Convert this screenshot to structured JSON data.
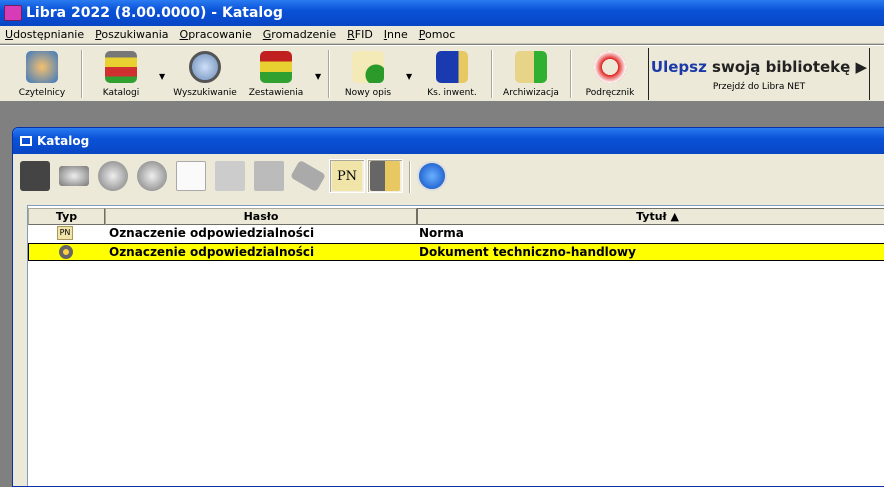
{
  "app": {
    "title": "Libra 2022 (8.00.0000) - Katalog"
  },
  "menu": [
    "Udostępnianie",
    "Poszukiwania",
    "Opracowanie",
    "Gromadzenie",
    "RFID",
    "Inne",
    "Pomoc"
  ],
  "toolbar": [
    {
      "label": "Czytelnicy",
      "icon": "readers-icon"
    },
    {
      "label": "Katalogi",
      "icon": "filing-cabinet-icon"
    },
    {
      "label": "Wyszukiwanie",
      "icon": "magnifier-icon"
    },
    {
      "label": "Zestawienia",
      "icon": "books-stack-icon"
    },
    {
      "label": "Nowy opis",
      "icon": "new-record-icon"
    },
    {
      "label": "Ks. inwent.",
      "icon": "inventory-book-icon"
    },
    {
      "label": "Archiwizacja",
      "icon": "archive-folder-icon"
    },
    {
      "label": "Podręcznik",
      "icon": "lifebuoy-icon"
    }
  ],
  "promo": {
    "highlight": "Ulepsz",
    "rest": " swoją bibliotekę ▶",
    "link": "Przejdź do Libra NET"
  },
  "window": {
    "title": "Katalog",
    "pn_label": "PN"
  },
  "table": {
    "columns": [
      "Typ",
      "Hasło",
      "Tytuł ▲"
    ],
    "rows": [
      {
        "type": "PN",
        "haslo": "Oznaczenie odpowiedzialności",
        "tytul": "Norma",
        "selected": false
      },
      {
        "type": "gear",
        "haslo": "Oznaczenie odpowiedzialności",
        "tytul": "Dokument techniczno-handlowy",
        "selected": true
      }
    ]
  },
  "colors": {
    "selection": "#ffff00",
    "titlebar": "#0a52d8",
    "face": "#ECE9D8"
  }
}
